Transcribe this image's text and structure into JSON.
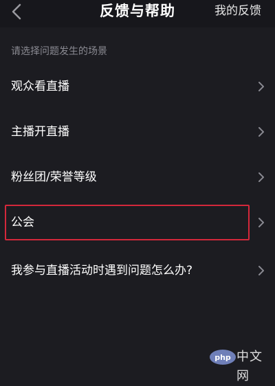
{
  "header": {
    "title": "反馈与帮助",
    "right_link": "我的反馈",
    "back_icon": "chevron-left-icon"
  },
  "section": {
    "label": "请选择问题发生的场景"
  },
  "items": [
    {
      "label": "观众看直播"
    },
    {
      "label": "主播开直播"
    },
    {
      "label": "粉丝团/荣誉等级"
    },
    {
      "label": "公会",
      "highlighted": true
    },
    {
      "label": "我参与直播活动时遇到问题怎么办?"
    }
  ],
  "watermark": {
    "logo_text": "php",
    "text": "中文网"
  },
  "colors": {
    "background": "#1c1c21",
    "highlight": "#d4283b",
    "label_muted": "#8a8a92"
  }
}
